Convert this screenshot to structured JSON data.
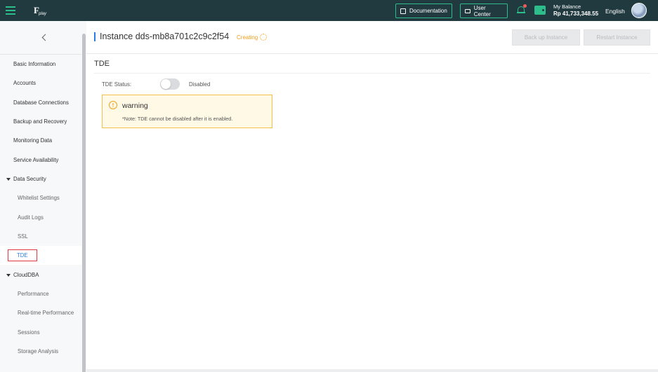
{
  "topbar": {
    "logo_text": "play",
    "documentation_label": "Documentation",
    "user_center_label": "User Center",
    "balance_label": "My Balance",
    "balance_amount": "Rp 41,733,348.55",
    "language": "English",
    "accent_color": "#2dbd8a",
    "bg_color": "#213a40",
    "notification_dot_color": "#f05a5a"
  },
  "sidebar": {
    "items": [
      {
        "label": "Basic Information",
        "level": 1
      },
      {
        "label": "Accounts",
        "level": 1
      },
      {
        "label": "Database Connections",
        "level": 1
      },
      {
        "label": "Backup and Recovery",
        "level": 1
      },
      {
        "label": "Monitoring Data",
        "level": 1
      },
      {
        "label": "Service Availability",
        "level": 1
      },
      {
        "label": "Data Security",
        "level": "group",
        "expanded": true
      },
      {
        "label": "Whitelist Settings",
        "level": 2
      },
      {
        "label": "Audit Logs",
        "level": 2
      },
      {
        "label": "SSL",
        "level": 2
      },
      {
        "label": "TDE",
        "level": 2,
        "active": true
      },
      {
        "label": "CloudDBA",
        "level": "group",
        "expanded": true
      },
      {
        "label": "Performance",
        "level": 2
      },
      {
        "label": "Real-time Performance",
        "level": 2
      },
      {
        "label": "Sessions",
        "level": 2
      },
      {
        "label": "Storage Analysis",
        "level": 2
      }
    ]
  },
  "header": {
    "title": "Instance dds-mb8a701c2c9c2f54",
    "status": "Creating",
    "backup_button": "Back up Instance",
    "restart_button": "Restart Instance"
  },
  "tde": {
    "section_title": "TDE",
    "status_label": "TDE Status:",
    "toggle_state": "Disabled",
    "toggle_on": false,
    "warning_title": "warning",
    "warning_note": "*Note: TDE cannot be disabled after it is enabled."
  }
}
